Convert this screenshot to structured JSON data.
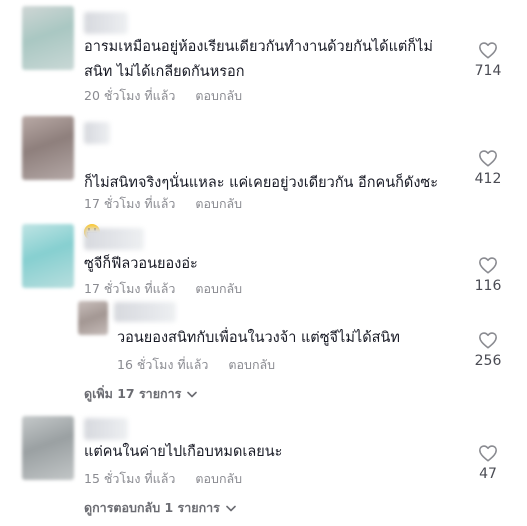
{
  "comments": [
    {
      "text": "อารมเหมือนอยู่ห้องเรียนเดียวกันทำงานด้วยกันได้แต่ก็ไม่\nสนิท ไม่ได้เกลียดกันหรอก",
      "time": "20 ชั่วโมง ที่แล้ว",
      "reply_label": "ตอบกลับ",
      "likes": "714"
    },
    {
      "text": "ก็ไม่สนิทจริงๆนั่นแหละ แค่เคยอยู่วงเดียวกัน อีกคนก็ดังซะ",
      "emoji": "grinning-face-emoji",
      "time": "17 ชั่วโมง ที่แล้ว",
      "reply_label": "ตอบกลับ",
      "likes": "412"
    },
    {
      "text": "ซูจีก็ฟีลวอนยองอ่ะ",
      "time": "17 ชั่วโมง ที่แล้ว",
      "reply_label": "ตอบกลับ",
      "likes": "116"
    },
    {
      "text": "วอนยองสนิทกับเพื่อนในวงจ้า แต่ซูจีไม่ได้สนิท",
      "time": "16 ชั่วโมง ที่แล้ว",
      "reply_label": "ตอบกลับ",
      "likes": "256",
      "is_reply": true
    },
    {
      "text": "แต่คนในค่ายไปเกือบหมดเลยนะ",
      "time": "15 ชั่วโมง ที่แล้ว",
      "reply_label": "ตอบกลับ",
      "likes": "47"
    }
  ],
  "view_more_replies_1": "ดูเพิ่ม 17 รายการ",
  "view_more_replies_2": "ดูการตอบกลับ 1 รายการ",
  "icons": {
    "like": "heart-outline-icon",
    "expand": "chevron-down-icon"
  },
  "colors": {
    "text": "#161823",
    "meta": "#8a8b91",
    "view_more": "#6b6c72",
    "heart": "#8a8b91"
  }
}
